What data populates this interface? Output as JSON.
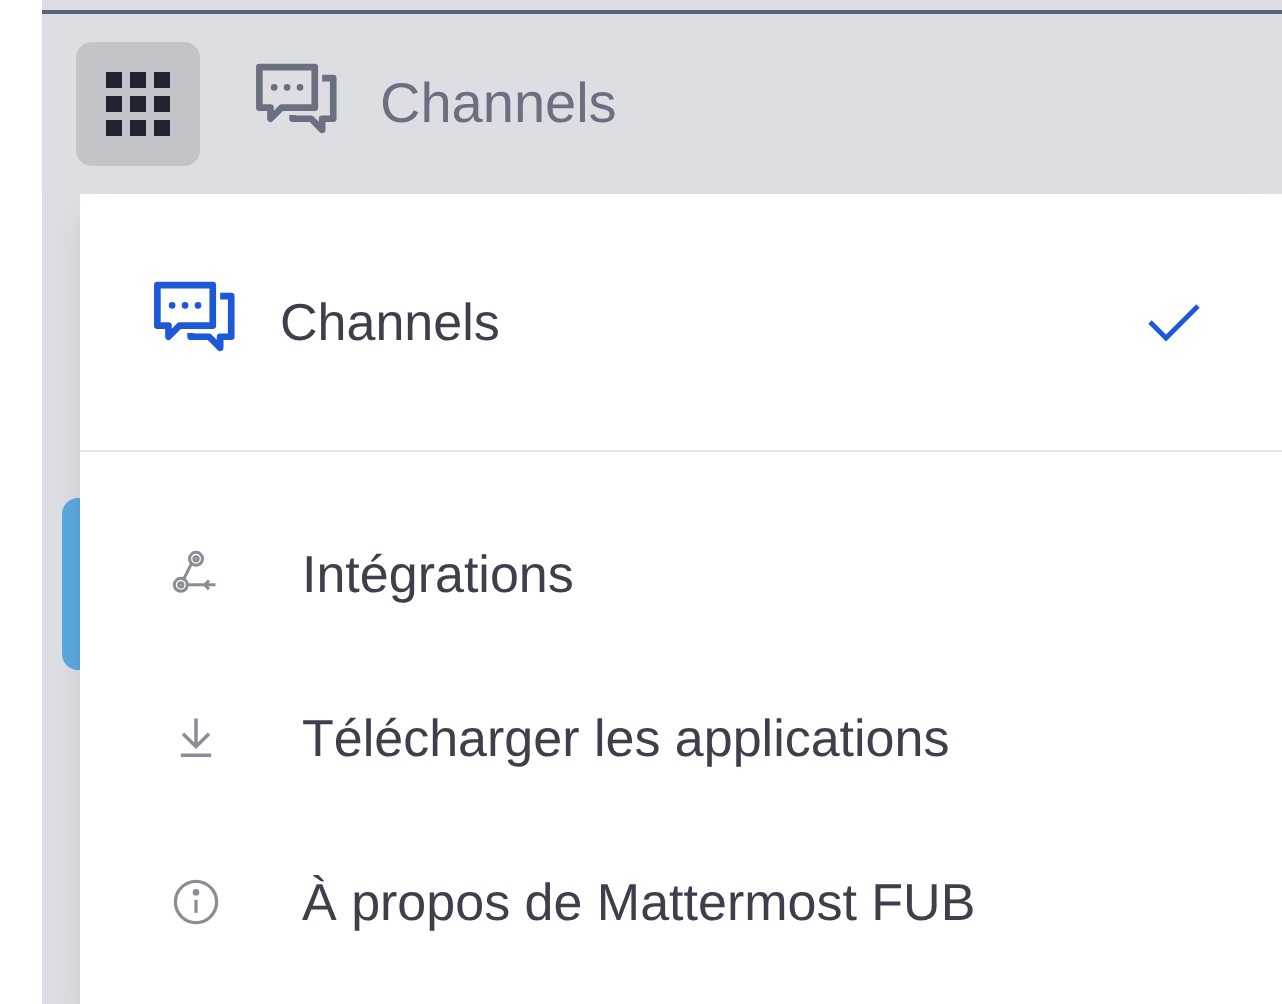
{
  "header": {
    "title": "Channels"
  },
  "products": [
    {
      "label": "Channels",
      "selected": true
    }
  ],
  "links": [
    {
      "label": "Intégrations",
      "kind": "integrations"
    },
    {
      "label": "Télécharger les applications",
      "kind": "download"
    },
    {
      "label": "À propos de Mattermost FUB",
      "kind": "info"
    }
  ]
}
